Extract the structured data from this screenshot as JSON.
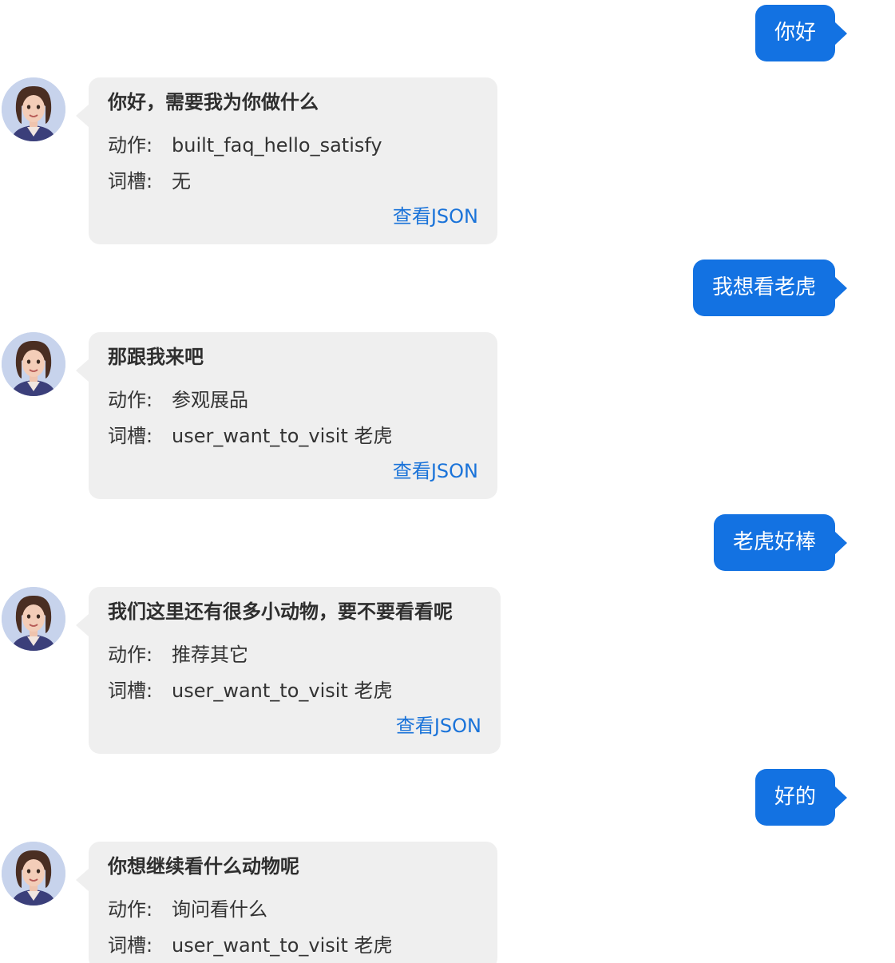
{
  "labels": {
    "action": "动作:",
    "slot": "词槽:",
    "view_json": "查看JSON"
  },
  "colors": {
    "user_bubble": "#1372e2",
    "bot_bubble": "#efefef",
    "link": "#1a73d9"
  },
  "messages": [
    {
      "role": "user",
      "text": "你好"
    },
    {
      "role": "bot",
      "title": "你好，需要我为你做什么",
      "action": "built_faq_hello_satisfy",
      "slot": "无",
      "link": "查看JSON"
    },
    {
      "role": "user",
      "text": "我想看老虎"
    },
    {
      "role": "bot",
      "title": "那跟我来吧",
      "action": "参观展品",
      "slot": "user_want_to_visit 老虎",
      "link": "查看JSON"
    },
    {
      "role": "user",
      "text": "老虎好棒"
    },
    {
      "role": "bot",
      "title": "我们这里还有很多小动物，要不要看看呢",
      "action": "推荐其它",
      "slot": "user_want_to_visit 老虎",
      "link": "查看JSON"
    },
    {
      "role": "user",
      "text": "好的"
    },
    {
      "role": "bot",
      "title": "你想继续看什么动物呢",
      "action": "询问看什么",
      "slot": "user_want_to_visit 老虎"
    }
  ]
}
